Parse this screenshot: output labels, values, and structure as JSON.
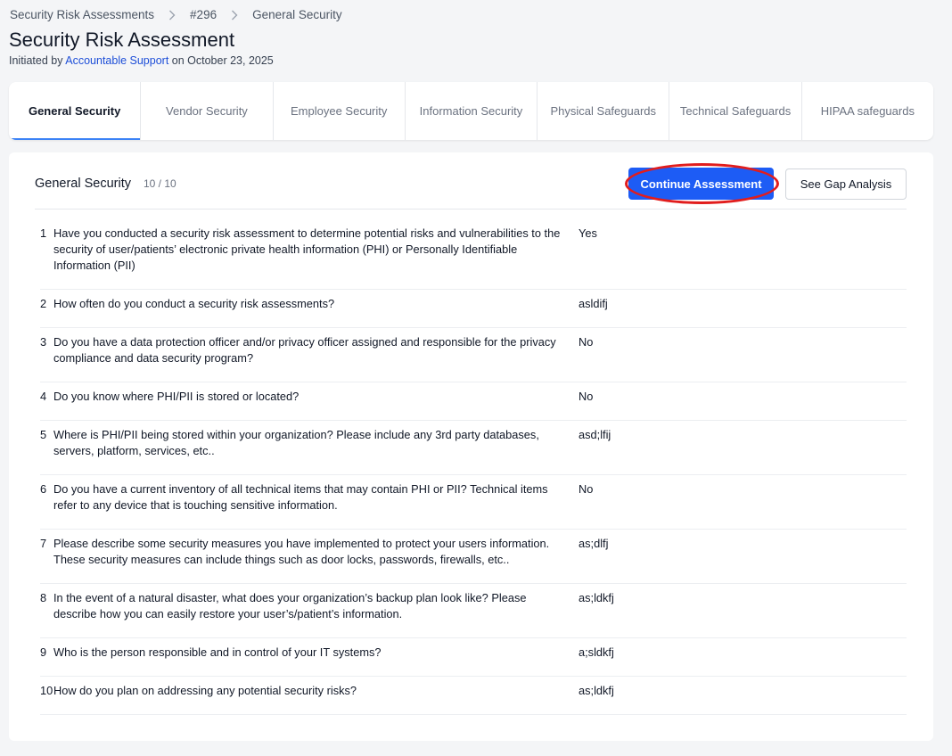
{
  "breadcrumb": {
    "items": [
      "Security Risk Assessments",
      "#296",
      "General Security"
    ]
  },
  "page": {
    "title": "Security Risk Assessment",
    "subtitle_prefix": "Initiated by ",
    "initiator": "Accountable Support",
    "subtitle_suffix": " on October 23, 2025"
  },
  "tabs": [
    {
      "label": "General Security",
      "active": true
    },
    {
      "label": "Vendor Security"
    },
    {
      "label": "Employee Security"
    },
    {
      "label": "Information Security"
    },
    {
      "label": "Physical Safeguards"
    },
    {
      "label": "Technical Safeguards"
    },
    {
      "label": "HIPAA safeguards"
    }
  ],
  "section": {
    "title": "General Security",
    "count": "10 / 10",
    "continue_label": "Continue Assessment",
    "gap_label": "See Gap Analysis"
  },
  "questions": [
    {
      "num": "1",
      "question": "Have you conducted a security risk assessment to determine potential risks and vulnerabilities to the security of user/patients’ electronic private health information (PHI) or Personally Identifiable Information (PII)",
      "answer": "Yes"
    },
    {
      "num": "2",
      "question": "How often do you conduct a security risk assessments?",
      "answer": "asldifj"
    },
    {
      "num": "3",
      "question": "Do you have a data protection officer and/or privacy officer assigned and responsible for the privacy compliance and data security program?",
      "answer": "No"
    },
    {
      "num": "4",
      "question": "Do you know where PHI/PII is stored or located?",
      "answer": "No"
    },
    {
      "num": "5",
      "question": "Where is PHI/PII being stored within your organization? Please include any 3rd party databases, servers, platform, services, etc..",
      "answer": "asd;lfij"
    },
    {
      "num": "6",
      "question": "Do you have a current inventory of all technical items that may contain PHI or PII? Technical items refer to any device that is touching sensitive information.",
      "answer": "No"
    },
    {
      "num": "7",
      "question": "Please describe some security measures you have implemented to protect your users information. These security measures can include things such as door locks, passwords, firewalls, etc..",
      "answer": "as;dlfj"
    },
    {
      "num": "8",
      "question": "In the event of a natural disaster, what does your organization’s backup plan look like? Please describe how you can easily restore your user’s/patient’s information.",
      "answer": "as;ldkfj"
    },
    {
      "num": "9",
      "question": "Who is the person responsible and in control of your IT systems?",
      "answer": "a;sldkfj"
    },
    {
      "num": "10",
      "question": "How do you plan on addressing any potential security risks?",
      "answer": "as;ldkfj"
    }
  ]
}
